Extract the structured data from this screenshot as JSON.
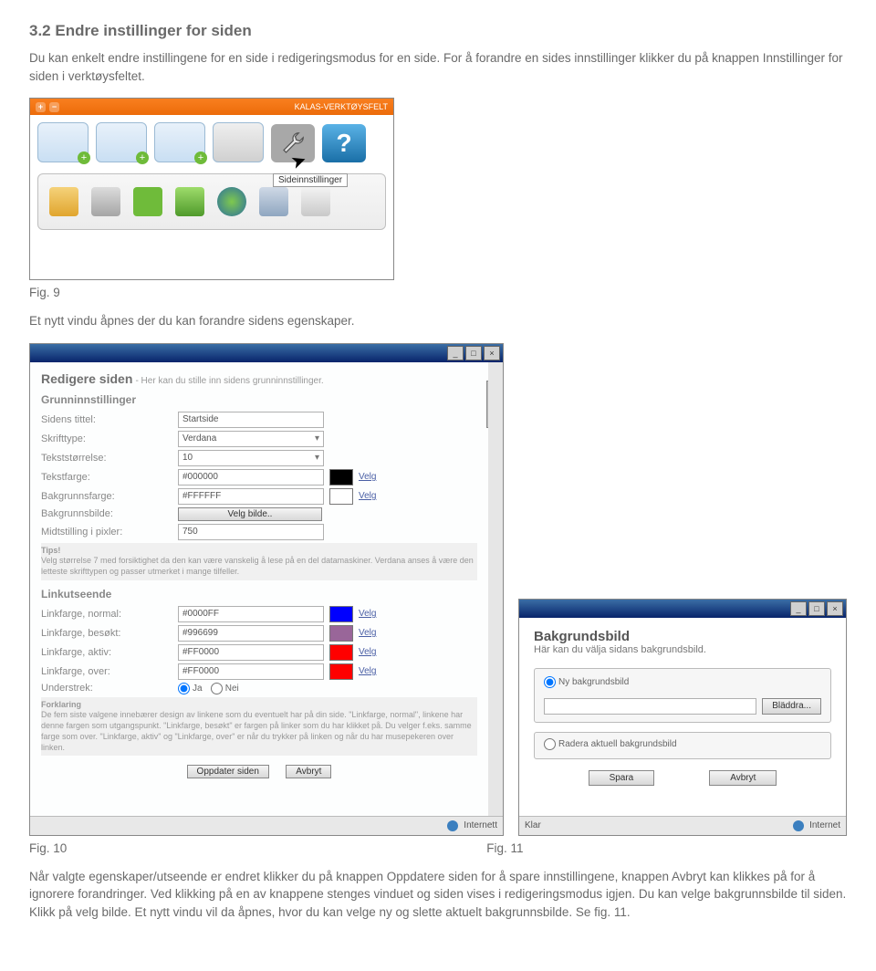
{
  "doc": {
    "heading": "3.2 Endre instillinger for siden",
    "intro": "Du kan enkelt endre instillingene for en side i redigeringsmodus for en side. For å forandre en sides innstillinger klikker du på knappen Innstillinger for siden i verktøysfeltet.",
    "fig9": "Fig. 9",
    "aftertool": "Et nytt vindu åpnes der du kan forandre sidens egenskaper.",
    "fig10": "Fig. 10",
    "fig11": "Fig. 11",
    "closing": "Når valgte egenskaper/utseende er endret klikker du på knappen Oppdatere siden for å spare innstillingene, knappen Avbryt kan klikkes på for å ignorere forandringer. Ved klikking på en av knappene stenges vinduet og siden vises i redigeringsmodus igjen. Du kan velge bakgrunnsbilde til siden. Klikk på velg bilde. Et nytt vindu vil da åpnes, hvor du kan velge ny og slette aktuelt bakgrunnsbilde. Se fig. 11."
  },
  "toolbar": {
    "title": "KALAS-VERKTØYSFELT",
    "tooltip": "Sideinnstillinger",
    "help": "?"
  },
  "settings": {
    "title": "Redigere siden",
    "subtitle": "- Her kan du stille inn sidens grunninnstillinger.",
    "basic_head": "Grunninnstillinger",
    "rows": {
      "site_title": {
        "label": "Sidens tittel:",
        "value": "Startside"
      },
      "font": {
        "label": "Skrifttype:",
        "value": "Verdana"
      },
      "size": {
        "label": "Tekststørrelse:",
        "value": "10"
      },
      "textcolor": {
        "label": "Tekstfarge:",
        "value": "#000000"
      },
      "bgcolor": {
        "label": "Bakgrunnsfarge:",
        "value": "#FFFFFF"
      },
      "bgimg": {
        "label": "Bakgrunnsbilde:",
        "button": "Velg bilde.."
      },
      "mid": {
        "label": "Midtstilling i pixler:",
        "value": "750"
      }
    },
    "tip_head": "Tips!",
    "tip_body": "Velg størrelse 7 med forsiktighet da den kan være vanskelig å lese på en del datamaskiner. Verdana anses å være den letteste skrifttypen og passer utmerket i mange tilfeller.",
    "link_head": "Linkutseende",
    "links": {
      "normal": {
        "label": "Linkfarge, normal:",
        "value": "#0000FF"
      },
      "visited": {
        "label": "Linkfarge, besøkt:",
        "value": "#996699"
      },
      "active": {
        "label": "Linkfarge, aktiv:",
        "value": "#FF0000"
      },
      "hover": {
        "label": "Linkfarge, over:",
        "value": "#FF0000"
      }
    },
    "underline": {
      "label": "Understrek:",
      "yes": "Ja",
      "no": "Nei"
    },
    "forkl_head": "Forklaring",
    "forkl_body": "De fem siste valgene innebærer design av linkene som du eventuelt har på din side. \"Linkfarge, normal\", linkene har denne fargen som utgangspunkt. \"Linkfarge, besøkt\" er fargen på linker som du har klikket på. Du velger f.eks. samme farge som over. \"Linkfarge, aktiv\" og \"Linkfarge, over\" er når du trykker på linken og når du har musepekeren over linken.",
    "btn_update": "Oppdater siden",
    "btn_cancel": "Avbryt",
    "status": "Internett",
    "velg": "Velg"
  },
  "bgdlg": {
    "title": "Bakgrundsbild",
    "desc": "Här kan du välja sidans bakgrundsbild.",
    "opt_new": "Ny bakgrundsbild",
    "browse": "Bläddra...",
    "opt_del": "Radera aktuell bakgrundsbild",
    "save": "Spara",
    "cancel": "Avbryt",
    "status_left": "Klar",
    "status_right": "Internet"
  }
}
